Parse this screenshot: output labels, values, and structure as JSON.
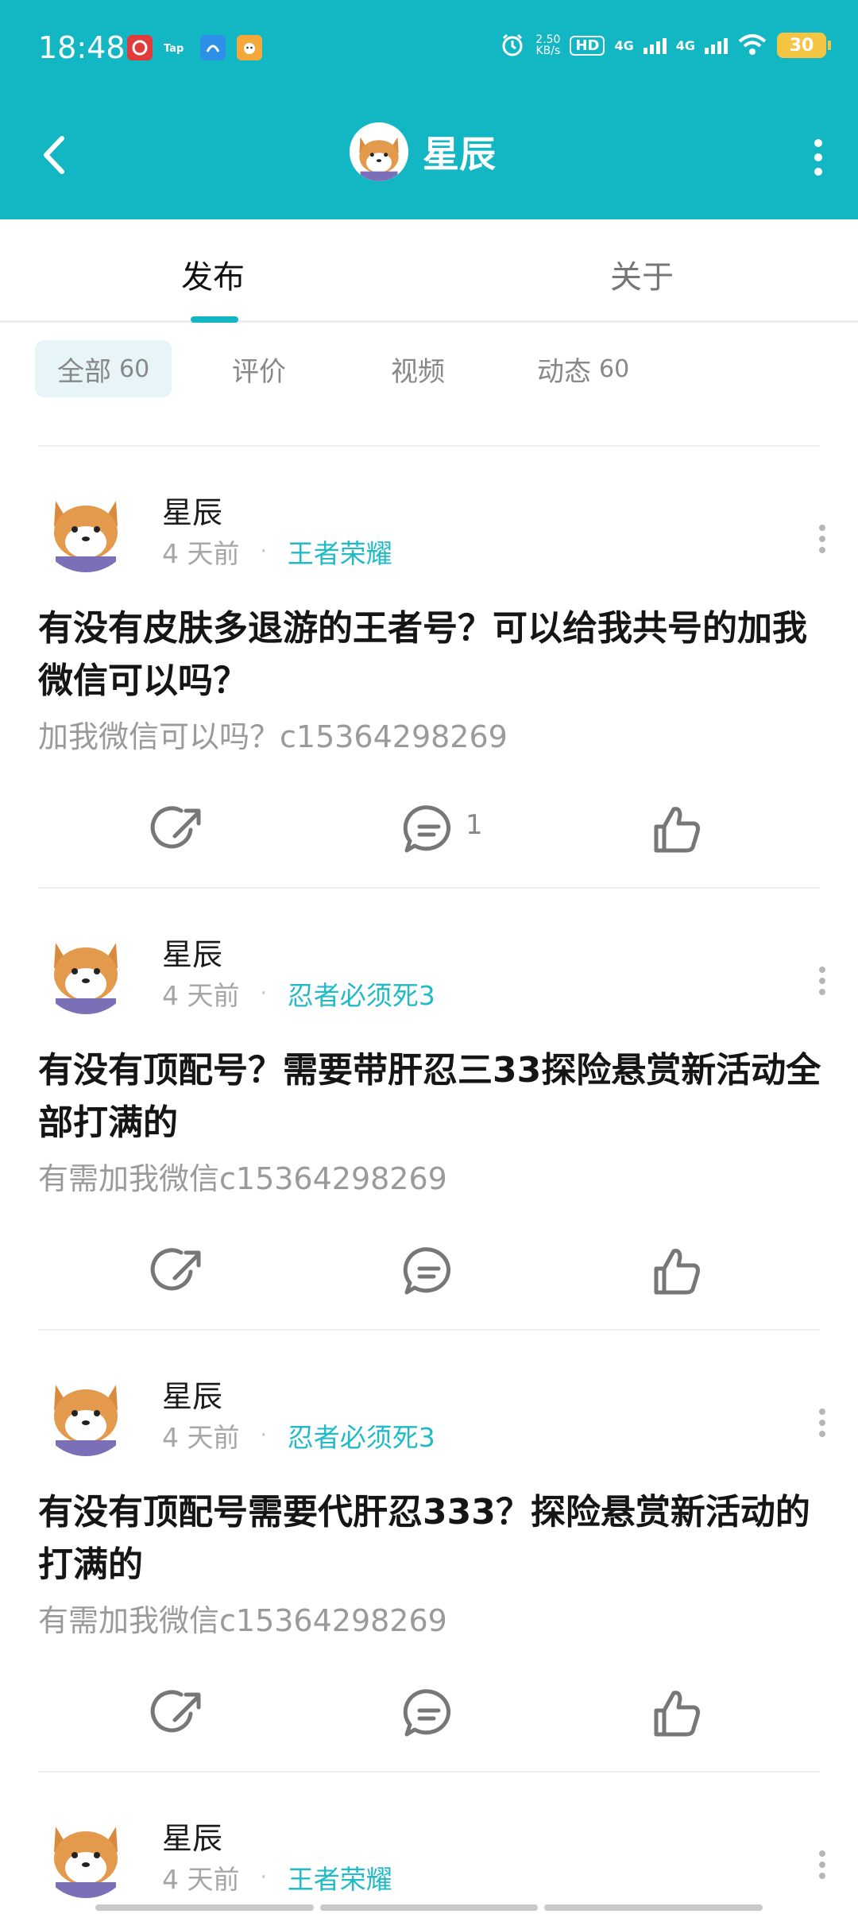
{
  "status_bar": {
    "time": "18:48",
    "net_speed": "2.50",
    "net_unit": "KB/s",
    "hd_label": "HD",
    "signal1_label": "4G",
    "signal2_label": "4G",
    "battery": "30",
    "app_icons": [
      "netease-music-icon",
      "tap-icon",
      "browser-icon",
      "game-icon"
    ]
  },
  "header": {
    "title": "星辰"
  },
  "tabs": [
    {
      "label": "发布"
    },
    {
      "label": "关于"
    }
  ],
  "filters": [
    {
      "label": "全部",
      "count": "60"
    },
    {
      "label": "评价"
    },
    {
      "label": "视频"
    },
    {
      "label": "动态",
      "count": "60"
    }
  ],
  "posts": [
    {
      "author": "星辰",
      "time": "4 天前",
      "game": "王者荣耀",
      "headline": "有没有皮肤多退游的王者号？可以给我共号的加我微信可以吗？",
      "body": "加我微信可以吗？c15364298269",
      "comment_count": "1"
    },
    {
      "author": "星辰",
      "time": "4 天前",
      "game": "忍者必须死3",
      "headline": "有没有顶配号？需要带肝忍三33探险悬赏新活动全部打满的",
      "body": "有需加我微信c15364298269",
      "comment_count": ""
    },
    {
      "author": "星辰",
      "time": "4 天前",
      "game": "忍者必须死3",
      "headline": "有没有顶配号需要代肝忍333？探险悬赏新活动的打满的",
      "body": "有需加我微信c15364298269",
      "comment_count": ""
    },
    {
      "author": "星辰",
      "time": "4 天前",
      "game": "王者荣耀"
    }
  ],
  "colors": {
    "accent": "#13b7c4",
    "game_tag": "#21bac7"
  }
}
